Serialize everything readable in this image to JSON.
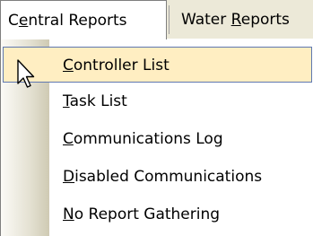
{
  "menubar": {
    "items": [
      {
        "label_pre": "C",
        "label_acc": "e",
        "label_post": "ntral Reports"
      },
      {
        "label_pre": "Water ",
        "label_acc": "R",
        "label_post": "eports"
      }
    ]
  },
  "dropdown": {
    "items": [
      {
        "acc": "C",
        "rest": "ontroller List",
        "selected": true
      },
      {
        "acc": "T",
        "rest": "ask List",
        "selected": false
      },
      {
        "acc": "C",
        "rest": "ommunications Log",
        "selected": false
      },
      {
        "acc": "D",
        "rest": "isabled Communications",
        "selected": false
      },
      {
        "acc": "N",
        "rest": "o Report Gathering",
        "selected": false
      }
    ]
  },
  "colors": {
    "menubar_bg": "#ece9d8",
    "highlight_bg": "#ffeec2",
    "highlight_border": "#5f78b0"
  },
  "icons": {
    "cursor": "arrow-cursor-icon"
  }
}
